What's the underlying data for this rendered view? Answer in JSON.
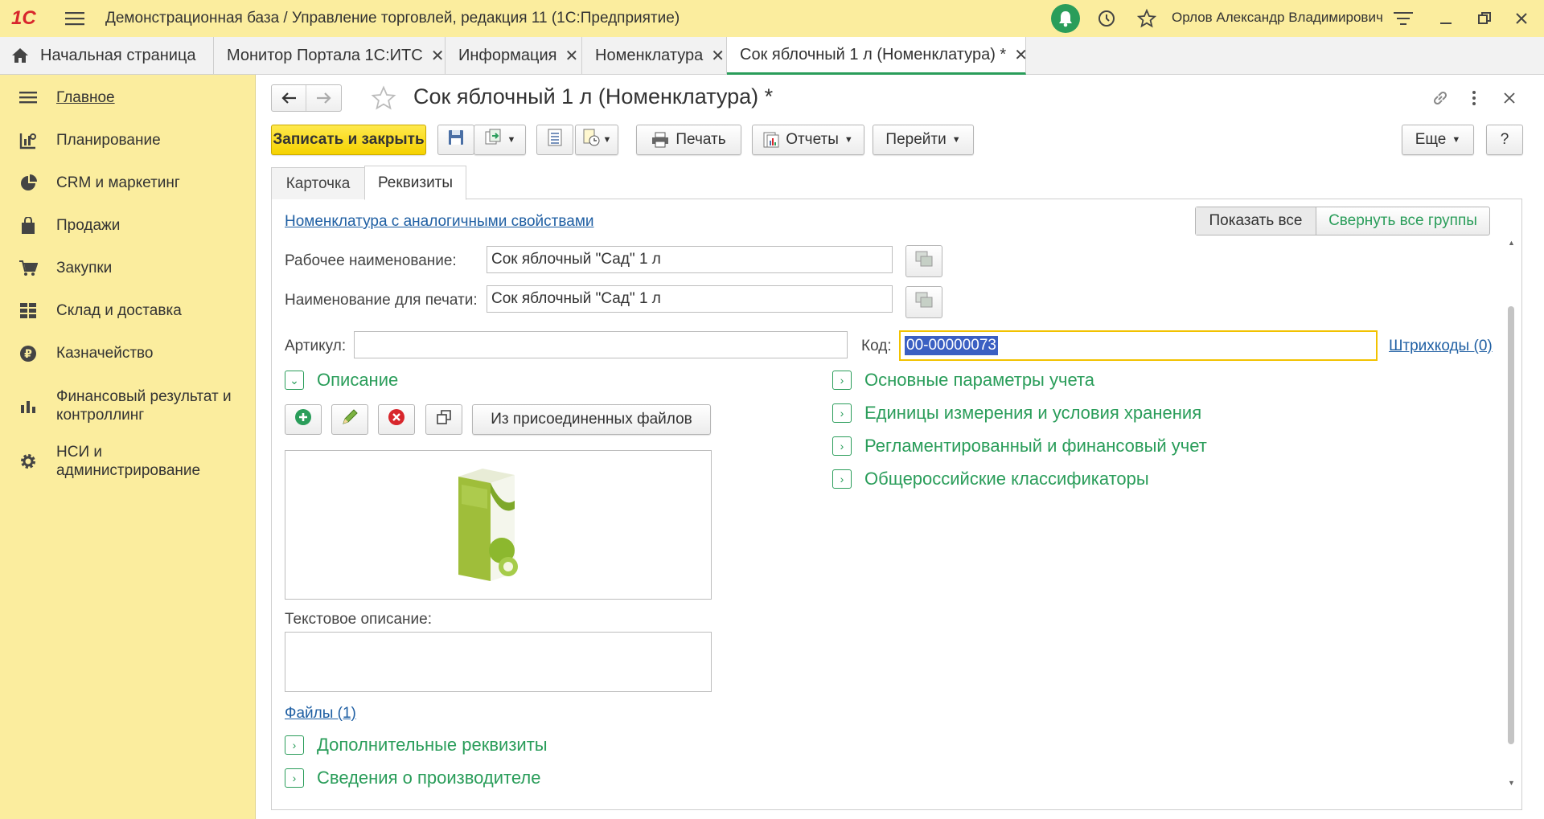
{
  "app": {
    "logo": "1С",
    "title": "Демонстрационная база / Управление торговлей, редакция 11  (1С:Предприятие)",
    "user": "Орлов Александр Владимирович"
  },
  "tabs": [
    {
      "label": "Начальная страница"
    },
    {
      "label": "Монитор Портала 1С:ИТС"
    },
    {
      "label": "Информация"
    },
    {
      "label": "Номенклатура"
    },
    {
      "label": "Сок яблочный 1 л (Номенклатура) *"
    }
  ],
  "sidebar": {
    "items": [
      {
        "label": "Главное",
        "icon": "menu-lines-icon"
      },
      {
        "label": "Планирование",
        "icon": "planning-icon"
      },
      {
        "label": "CRM и маркетинг",
        "icon": "pie-icon"
      },
      {
        "label": "Продажи",
        "icon": "bag-icon"
      },
      {
        "label": "Закупки",
        "icon": "cart-icon"
      },
      {
        "label": "Склад и доставка",
        "icon": "grid-icon"
      },
      {
        "label": "Казначейство",
        "icon": "ruble-icon"
      },
      {
        "label": "Финансовый результат и контроллинг",
        "icon": "bars-icon"
      },
      {
        "label": "НСИ и администрирование",
        "icon": "gear-icon"
      }
    ]
  },
  "form": {
    "title": "Сок яблочный 1 л (Номенклатура) *",
    "toolbar": {
      "save_close": "Записать и закрыть",
      "print": "Печать",
      "reports": "Отчеты",
      "goto": "Перейти",
      "more": "Еще",
      "help": "?"
    },
    "subtabs": [
      "Карточка",
      "Реквизиты"
    ],
    "similar_link": "Номенклатура с аналогичными свойствами",
    "show_all": "Показать все",
    "collapse_all": "Свернуть все группы",
    "work_name_label": "Рабочее наименование:",
    "work_name_value": "Сок яблочный  \"Сад\"  1 л",
    "print_name_label": "Наименование для печати:",
    "print_name_value": "Сок яблочный \"Сад\" 1 л",
    "article_label": "Артикул:",
    "article_value": "",
    "code_label": "Код:",
    "code_value": "00-00000073",
    "barcodes_link": "Штрихкоды (0)",
    "description_group": "Описание",
    "attach_button": "Из присоединенных файлов",
    "text_desc_label": "Текстовое описание:",
    "files_link": "Файлы (1)",
    "right_groups": [
      "Основные параметры учета",
      "Единицы измерения и условия хранения",
      "Регламентированный и финансовый учет",
      "Общероссийские классификаторы"
    ],
    "bottom_groups": [
      "Дополнительные реквизиты",
      "Сведения о производителе"
    ]
  },
  "colors": {
    "topbar": "#fbed9e",
    "accent_green": "#2a9d5a",
    "primary_button": "#f5d200",
    "link": "#1f5fa3"
  }
}
